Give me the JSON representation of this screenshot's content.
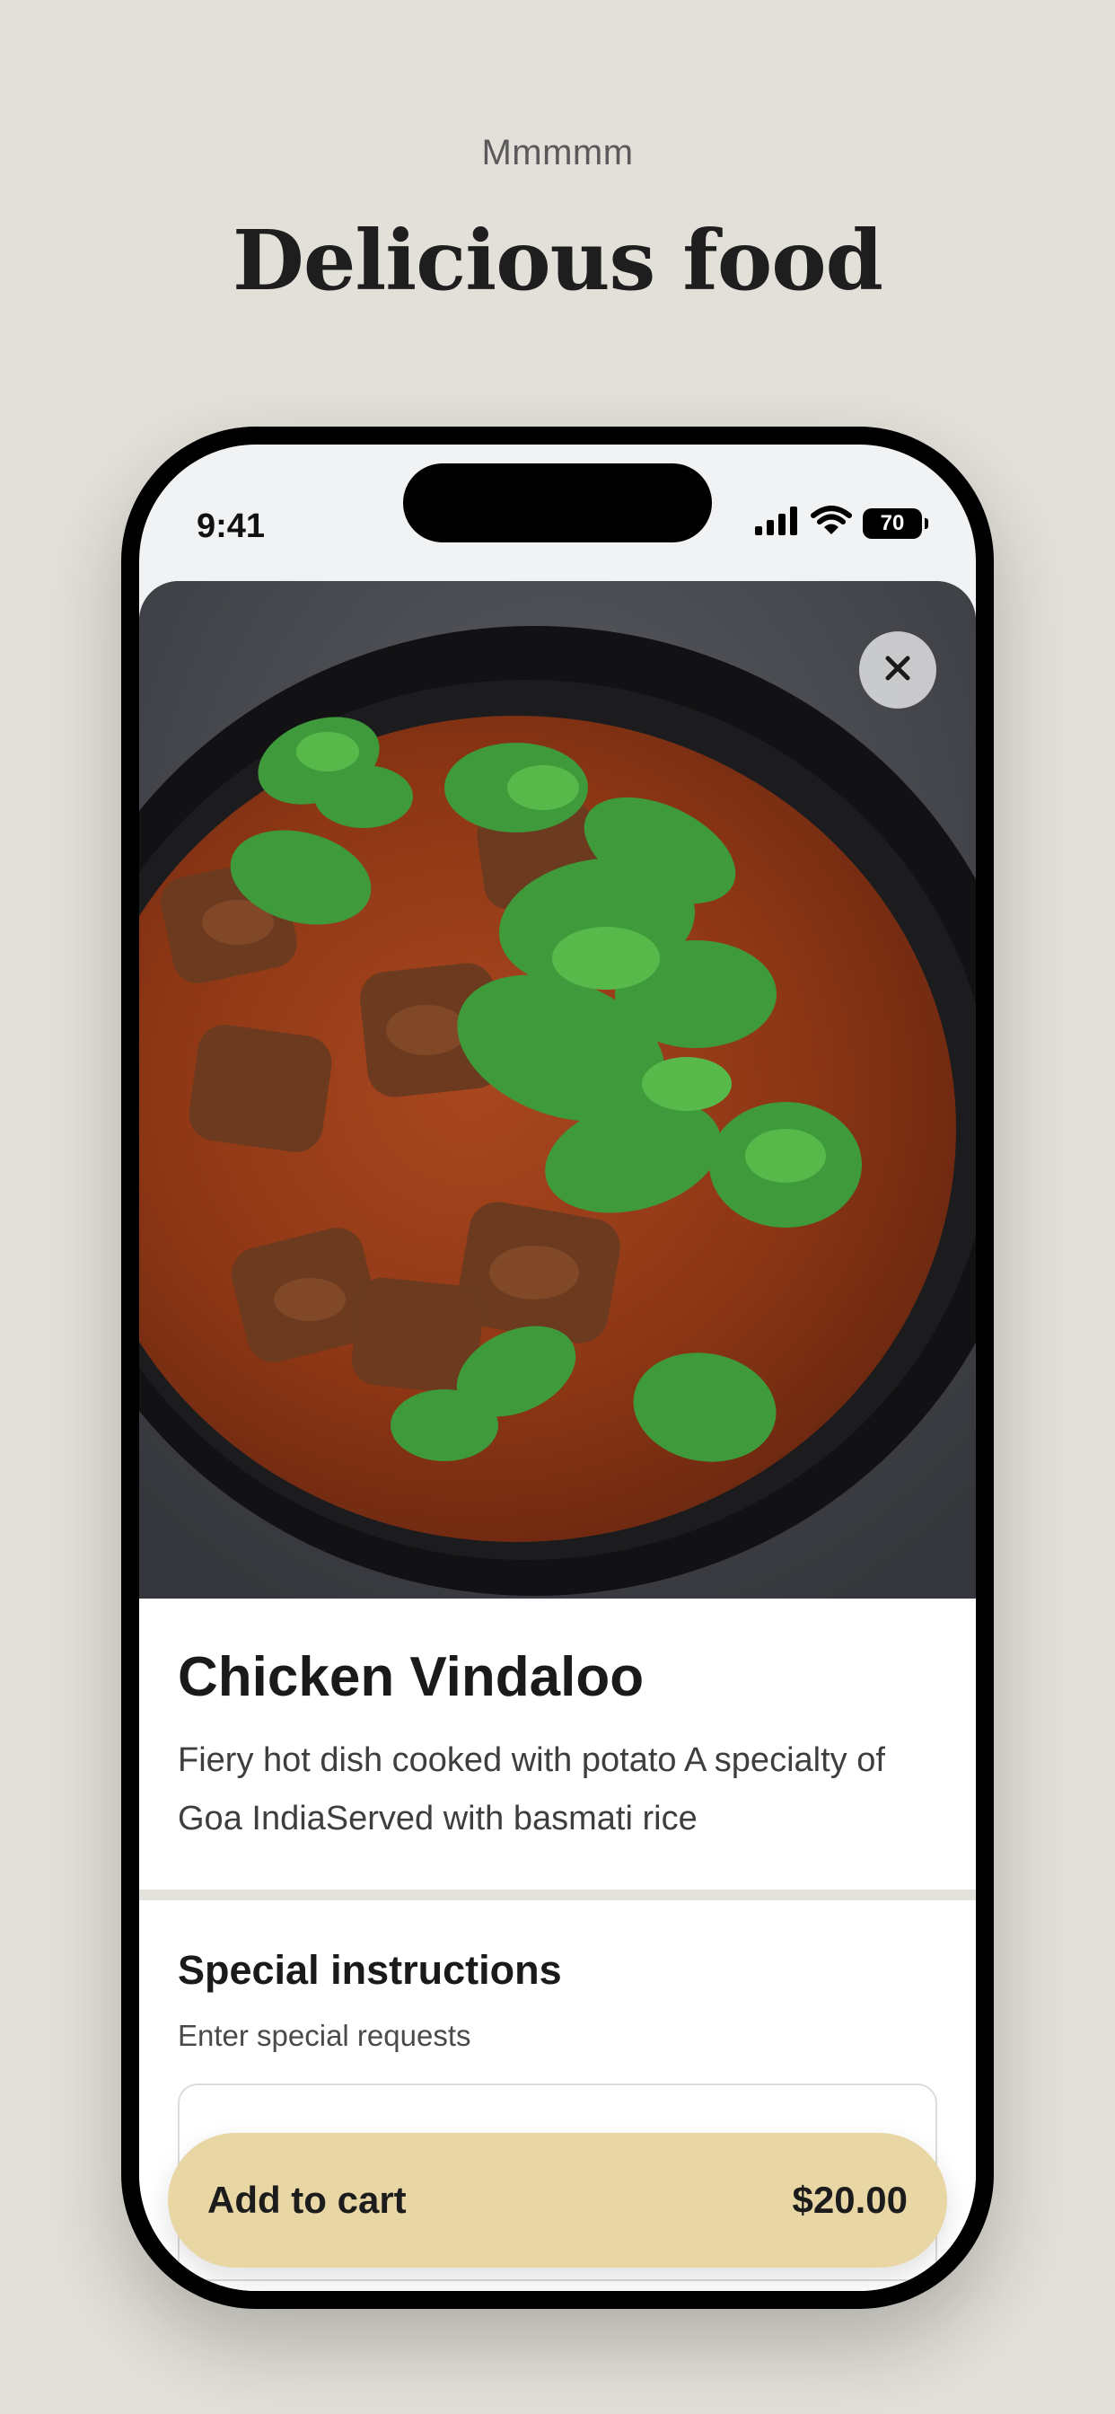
{
  "header": {
    "eyebrow": "Mmmmm",
    "title": "Delicious food"
  },
  "status_bar": {
    "time": "9:41",
    "battery": "70",
    "icons": [
      "signal-icon",
      "wifi-icon",
      "battery-icon"
    ]
  },
  "hero": {
    "image": "chicken-vindaloo-photo",
    "close_icon": "close-icon"
  },
  "item": {
    "name": "Chicken Vindaloo",
    "description": "Fiery hot dish cooked with potato A specialty of Goa IndiaServed with basmati rice"
  },
  "instructions": {
    "title": "Special instructions",
    "help": "Enter special requests",
    "value": ""
  },
  "cart": {
    "label": "Add to cart",
    "price": "$20.00"
  },
  "colors": {
    "page_bg": "#e3e0d9",
    "accent": "#e8d6a5",
    "text": "#1a1a1a"
  }
}
